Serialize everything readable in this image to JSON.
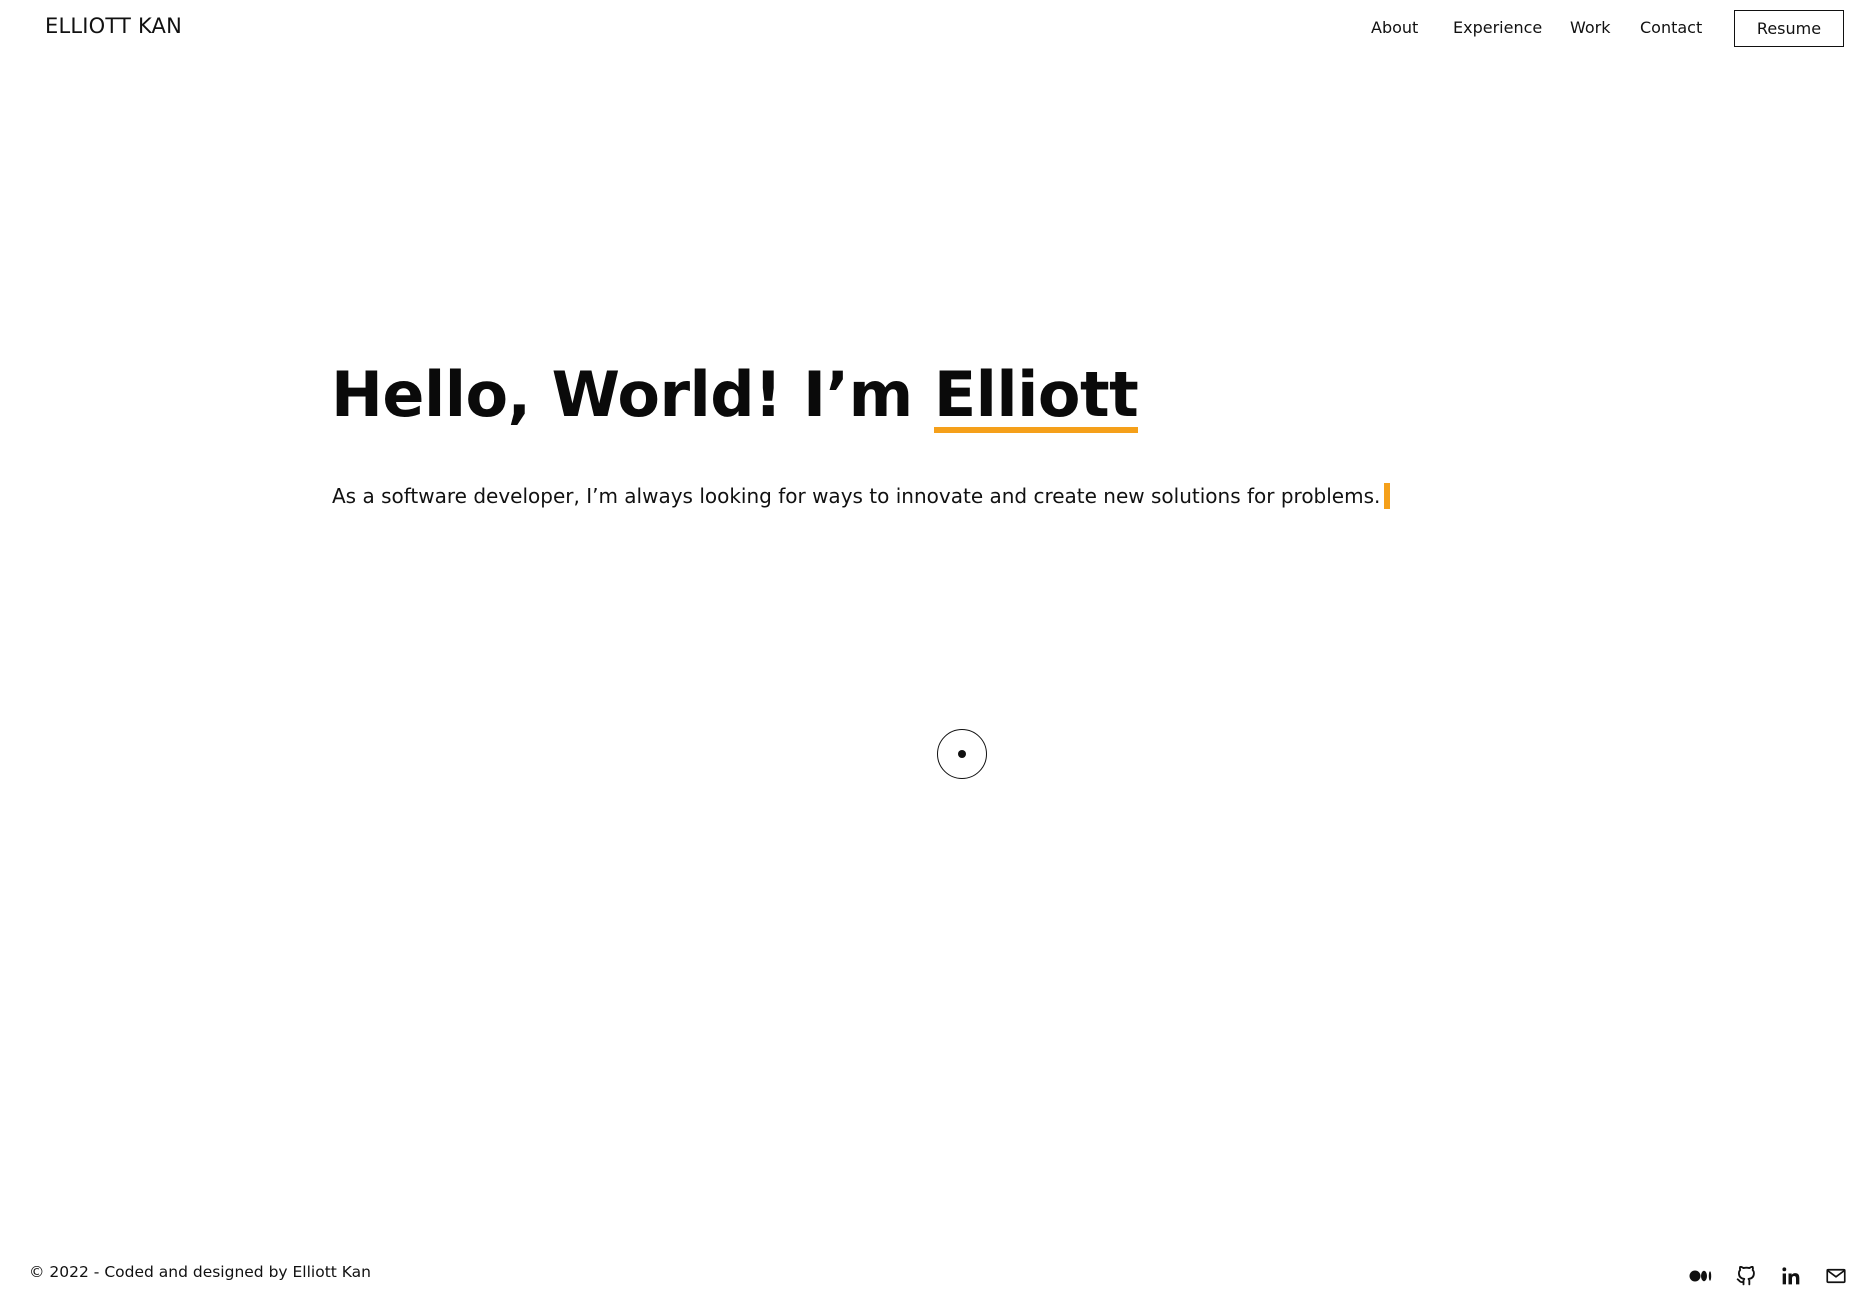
{
  "header": {
    "logo": "ELLIOTT KAN",
    "nav": [
      {
        "label": "About"
      },
      {
        "label": "Experience"
      },
      {
        "label": "Work"
      },
      {
        "label": "Contact"
      }
    ],
    "resume_label": "Resume"
  },
  "hero": {
    "title_prefix": "Hello, World! I’m ",
    "title_name": "Elliott",
    "subtitle": "As a software developer, I’m always looking for ways to innovate and create new solutions for problems."
  },
  "footer": {
    "copyright": "© 2022 - Coded and designed by Elliott Kan",
    "social_icons": [
      "medium-icon",
      "github-icon",
      "linkedin-icon",
      "mail-icon"
    ]
  },
  "colors": {
    "accent": "#f5a01a",
    "text": "#111111",
    "background": "#ffffff"
  }
}
